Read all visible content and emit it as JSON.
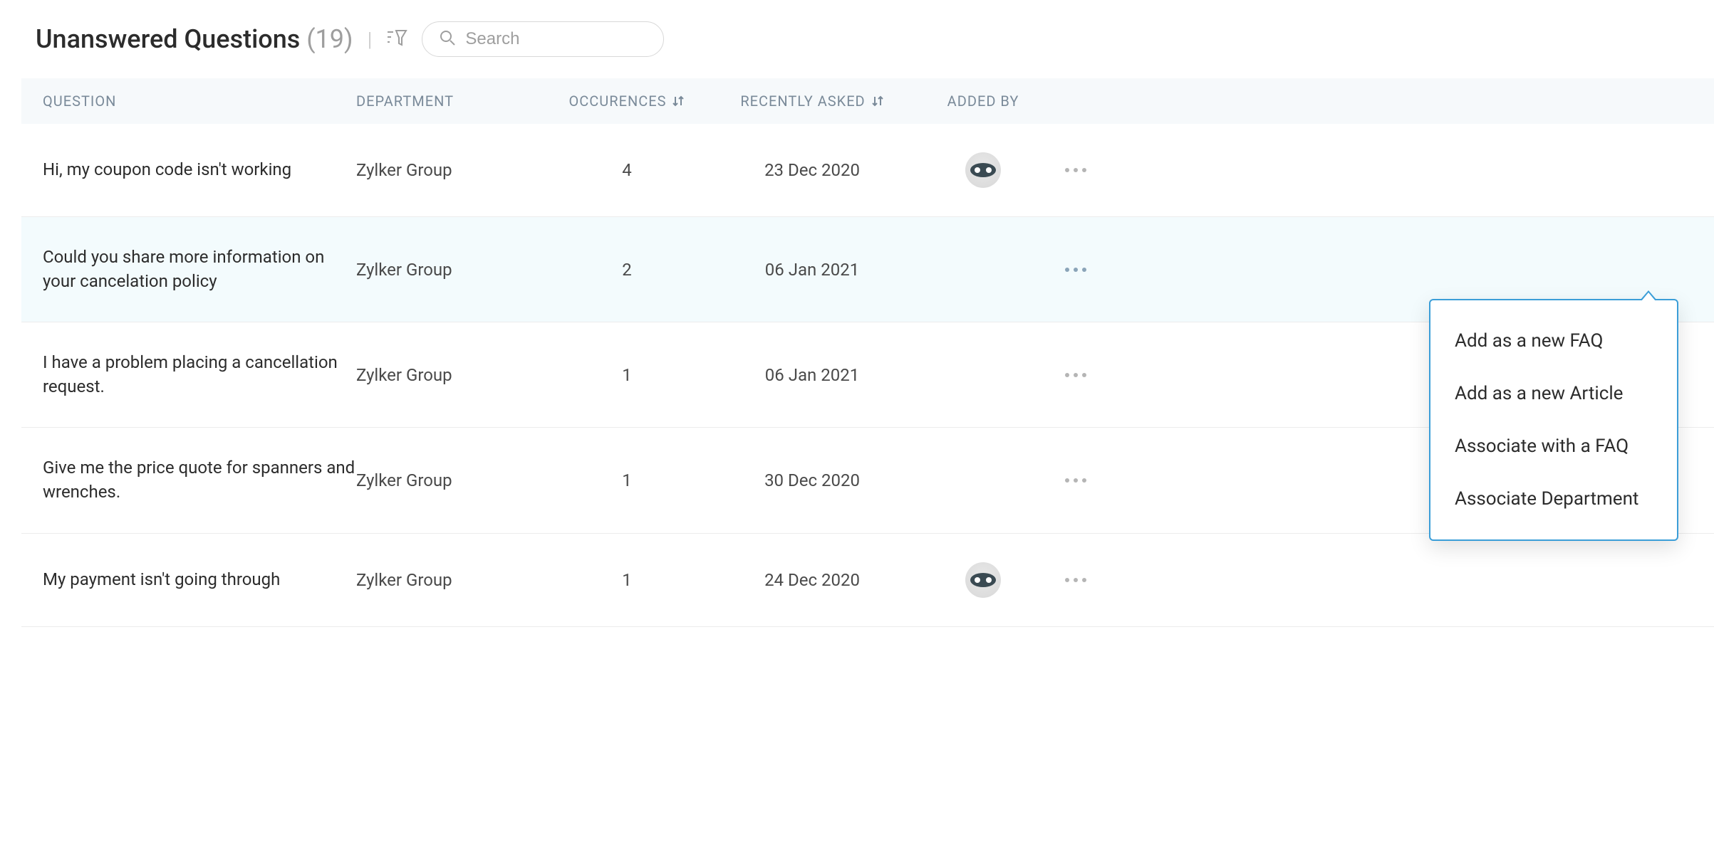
{
  "header": {
    "title": "Unanswered Questions",
    "count": "(19)",
    "search_placeholder": "Search"
  },
  "columns": {
    "question": "QUESTION",
    "department": "DEPARTMENT",
    "occurrences": "OCCURENCES",
    "recently_asked": "RECENTLY ASKED",
    "added_by": "ADDED BY"
  },
  "rows": [
    {
      "question": "Hi, my coupon code isn't working",
      "department": "Zylker Group",
      "occurrences": "4",
      "recently_asked": "23 Dec 2020",
      "show_avatar": true
    },
    {
      "question": "Could you share more information on your cancelation policy",
      "department": "Zylker Group",
      "occurrences": "2",
      "recently_asked": "06 Jan 2021",
      "show_avatar": false,
      "active": true
    },
    {
      "question": "I have a problem placing a cancellation request.",
      "department": "Zylker Group",
      "occurrences": "1",
      "recently_asked": "06 Jan 2021",
      "show_avatar": false
    },
    {
      "question": "Give me the price quote for spanners and wrenches.",
      "department": "Zylker Group",
      "occurrences": "1",
      "recently_asked": "30 Dec 2020",
      "show_avatar": false
    },
    {
      "question": "My payment isn't going through",
      "department": "Zylker Group",
      "occurrences": "1",
      "recently_asked": "24 Dec 2020",
      "show_avatar": true
    }
  ],
  "popover": {
    "items": [
      "Add as a new FAQ",
      "Add as a new Article",
      "Associate with a FAQ",
      "Associate Department"
    ]
  }
}
